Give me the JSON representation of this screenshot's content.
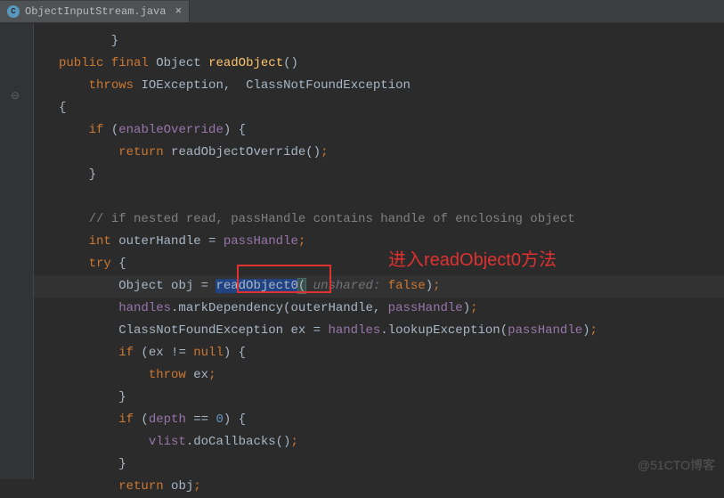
{
  "tab": {
    "label": "ObjectInputStream.java",
    "close": "×"
  },
  "code": {
    "ellipsis": "}",
    "l1_public": "public",
    "l1_final": "final",
    "l1_type": "Object",
    "l1_method": "readObject",
    "l1_parens": "()",
    "l2_throws": "throws",
    "l2_ex1": "IOException",
    "l2_comma": ",",
    "l2_ex2": "ClassNotFoundException",
    "l3_brace": "{",
    "l4_if": "if",
    "l4_open": "(",
    "l4_cond": "enableOverride",
    "l4_close": ") {",
    "l5_return": "return",
    "l5_call": "readObjectOverride()",
    "l5_semi": ";",
    "l6_brace": "}",
    "l7_comment": "// if nested read, passHandle contains handle of enclosing object",
    "l8_int": "int",
    "l8_var": "outerHandle = ",
    "l8_field": "passHandle",
    "l8_semi": ";",
    "l9_try": "try",
    "l9_brace": " {",
    "l10_type": "Object",
    "l10_var": " obj = ",
    "l10_method": "readObject0",
    "l10_open": "(",
    "l10_param": " unshared: ",
    "l10_false": "false",
    "l10_close": ")",
    "l10_semi": ";",
    "l11_handles": "handles",
    "l11_call": ".markDependency(outerHandle, ",
    "l11_ph": "passHandle",
    "l11_close": ")",
    "l11_semi": ";",
    "l12_type": "ClassNotFoundException ex = ",
    "l12_handles": "handles",
    "l12_call": ".lookupException(",
    "l12_ph": "passHandle",
    "l12_close": ")",
    "l12_semi": ";",
    "l13_if": "if",
    "l13_open": " (ex != ",
    "l13_null": "null",
    "l13_close": ") {",
    "l14_throw": "throw",
    "l14_var": " ex",
    "l14_semi": ";",
    "l15_brace": "}",
    "l16_if": "if",
    "l16_open": " (",
    "l16_depth": "depth",
    "l16_eq": " == ",
    "l16_zero": "0",
    "l16_close": ") {",
    "l17_vlist": "vlist",
    "l17_call": ".doCallbacks()",
    "l17_semi": ";",
    "l18_brace": "}",
    "l19_return": "return",
    "l19_var": " obj",
    "l19_semi": ";"
  },
  "annotation": "进入readObject0方法",
  "watermark": "@51CTO博客"
}
